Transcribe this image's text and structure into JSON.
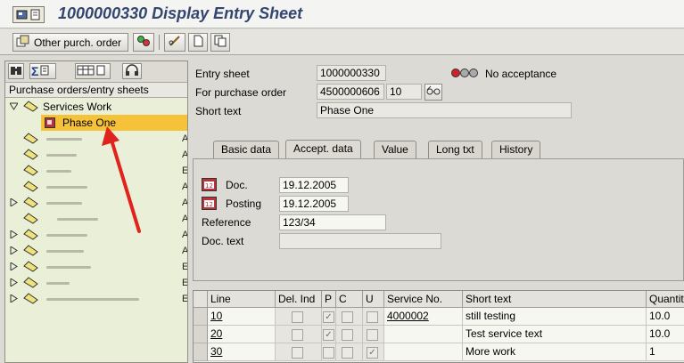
{
  "title": "1000000330 Display Entry Sheet",
  "toolbar": {
    "other_po_label": "Other purch. order"
  },
  "tree": {
    "header": "Purchase orders/entry sheets",
    "root_label": "Services Work",
    "selected_label": "Phase One"
  },
  "form": {
    "entry_sheet_label": "Entry sheet",
    "entry_sheet_value": "1000000330",
    "status_text": "No acceptance",
    "po_label": "For purchase order",
    "po_value": "4500000606",
    "po_item": "10",
    "short_text_label": "Short text",
    "short_text_value": "Phase One"
  },
  "tabs": [
    "Basic data",
    "Accept. data",
    "Value",
    "Long txt",
    "History"
  ],
  "accept": {
    "doc_label": "Doc.",
    "doc_value": "19.12.2005",
    "posting_label": "Posting",
    "posting_value": "19.12.2005",
    "reference_label": "Reference",
    "reference_value": "123/34",
    "doc_text_label": "Doc. text",
    "doc_text_value": ""
  },
  "table": {
    "headers": [
      "Line",
      "Del. Ind",
      "P",
      "C",
      "U",
      "Service No.",
      "Short text",
      "Quantity"
    ],
    "rows": [
      {
        "line": "10",
        "service_no": "4000002",
        "short_text": "still testing",
        "quantity": "10.0"
      },
      {
        "line": "20",
        "service_no": "",
        "short_text": "Test service text",
        "quantity": "10.0"
      },
      {
        "line": "30",
        "service_no": "",
        "short_text": "More work",
        "quantity": "1"
      }
    ]
  },
  "colors": {
    "title": "#33466f",
    "tree_bg": "#eaf0d8",
    "selection": "#f5c23a",
    "arrow": "#e0231c"
  }
}
